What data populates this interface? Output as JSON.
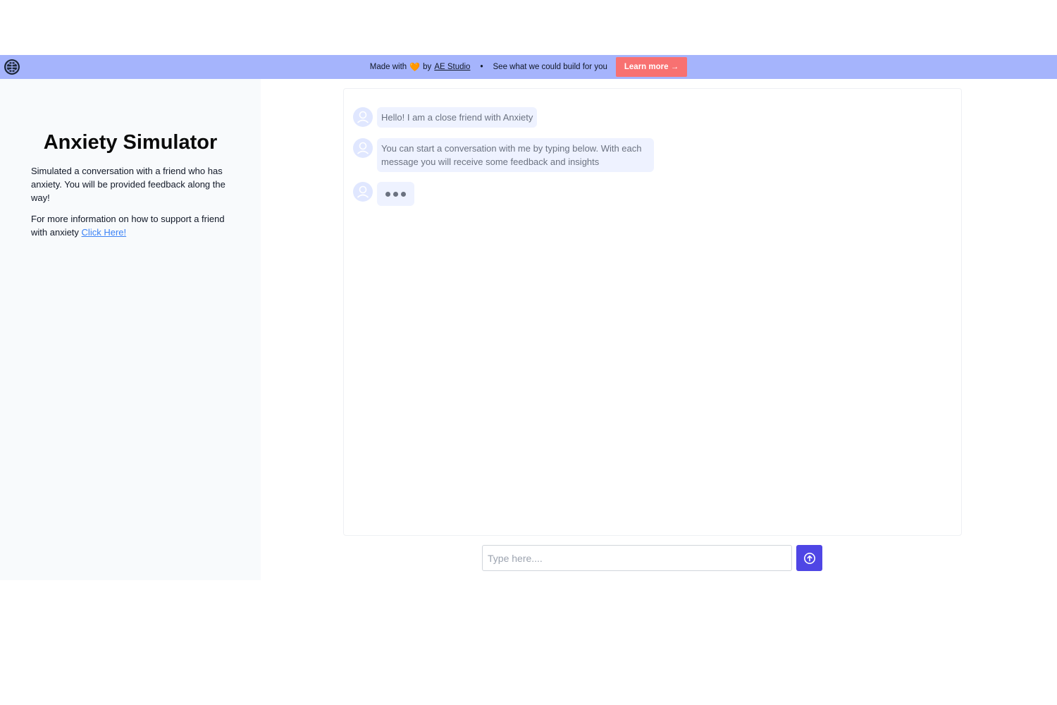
{
  "banner": {
    "made_with": "Made with",
    "heart": "🧡",
    "by": "by",
    "studio_link": "AE Studio",
    "separator": "•",
    "tagline": "See what we could build for you",
    "learn_more": "Learn more →",
    "background": "#a5b4fc",
    "button_color": "#f87171"
  },
  "sidebar": {
    "title": "Anxiety Simulator",
    "description": "Simulated a conversation with a friend who has anxiety. You will be provided feedback along the way!",
    "more_info": "For more information on how to support a friend with anxiety",
    "more_link": "Click Here!"
  },
  "chat": {
    "messages": [
      {
        "text": "Hello! I am a close friend with Anxiety",
        "avatar": "user-avatar-icon"
      },
      {
        "text": "You can start a conversation with me by typing below. With each message you will receive some feedback and insights",
        "avatar": "user-avatar-icon"
      }
    ],
    "typing": "typing-indicator"
  },
  "input": {
    "placeholder": "Type here....",
    "value": "",
    "send_icon": "arrow-up-circle-icon",
    "send_color": "#4f46e5"
  }
}
